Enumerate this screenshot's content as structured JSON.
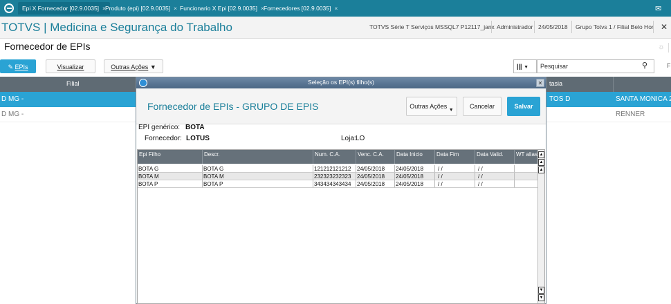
{
  "tabs": [
    {
      "label": "Epi X Fornecedor [02.9.0035]"
    },
    {
      "label": "Produto (epi) [02.9.0035]"
    },
    {
      "label": "Funcionario X Epi [02.9.0035]"
    },
    {
      "label": "Fornecedores [02.9.0035]"
    }
  ],
  "tab_close": "×",
  "header": {
    "app_title": "TOTVS | Medicina e Segurança do Trabalho",
    "environment": "TOTVS Série T Serviços MSSQL7 P12117_janx",
    "user": "Administrador",
    "date": "24/05/2018",
    "branch": "Grupo Totvs 1 / Filial Belo Hor",
    "close": "✕"
  },
  "page_title": "Fornecedor de EPIs",
  "toolbar": {
    "epis_label": "EPIs",
    "visualizar_label": "Visualizar",
    "outras_label": "Outras Ações",
    "search_placeholder": "Pesquisar",
    "cut_text": "F"
  },
  "bg_grid": {
    "headers": {
      "filial": "Filial",
      "fantasia": "tasia"
    },
    "rows": [
      {
        "filial": "D MG  -",
        "fantasia": "TOS D",
        "name": "SANTA MONICA 2"
      },
      {
        "filial": "D MG  -",
        "fantasia": "",
        "name": "RENNER"
      }
    ]
  },
  "modal": {
    "title": "Seleção os EPI(s) filho(s)",
    "heading": "Fornecedor de EPIs - GRUPO DE EPIS",
    "outras_label": "Outras Ações",
    "cancel_label": "Cancelar",
    "save_label": "Salvar",
    "epi_label": "EPI genérico:",
    "epi_value": "BOTA",
    "fornecedor_label": "Fornecedor:",
    "fornecedor_value": "LOTUS",
    "loja_label": "Loja:",
    "loja_value": "LO",
    "table": {
      "headers": [
        "Epi Filho",
        "Descr.",
        "Num. C.A.",
        "Venc. C.A.",
        "Data Inicio",
        "Data Fim",
        "Data Valid.",
        "WT alias"
      ],
      "rows": [
        [
          "BOTA G",
          "BOTA G",
          "121212121212",
          "24/05/2018",
          "24/05/2018",
          "/ /",
          "/ /",
          ""
        ],
        [
          "BOTA M",
          "BOTA M",
          "232323232323",
          "24/05/2018",
          "24/05/2018",
          "/ /",
          "/ /",
          ""
        ],
        [
          "BOTA P",
          "BOTA P",
          "343434343434",
          "24/05/2018",
          "24/05/2018",
          "/ /",
          "/ /",
          ""
        ]
      ]
    }
  }
}
